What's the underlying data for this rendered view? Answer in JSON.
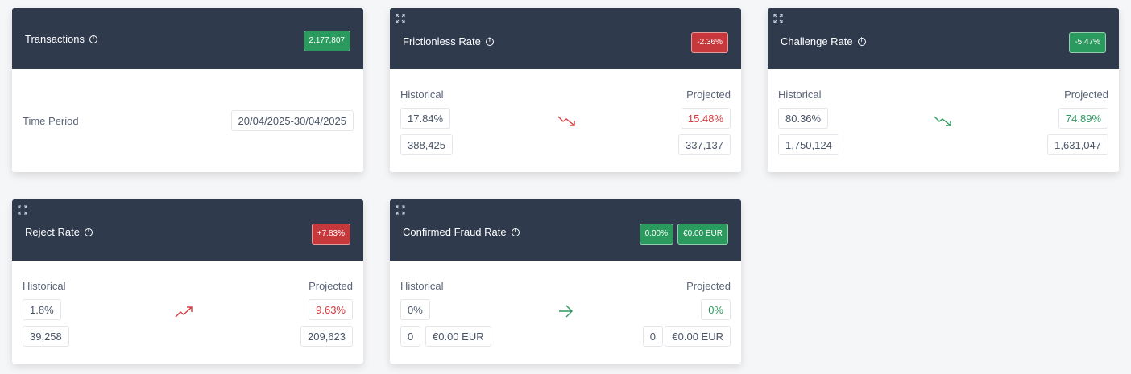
{
  "colors": {
    "header": "#2f3a4d",
    "positive": "#2b9a5e",
    "negative": "#c7383c"
  },
  "labels": {
    "historical": "Historical",
    "projected": "Projected"
  },
  "transactions": {
    "title": "Transactions",
    "badge": "2,177,807",
    "period_label": "Time Period",
    "period_value": "20/04/2025-30/04/2025"
  },
  "frictionless": {
    "title": "Frictionless Rate",
    "badge": "-2.36%",
    "hist_rate": "17.84%",
    "hist_count": "388,425",
    "proj_rate": "15.48%",
    "proj_count": "337,137",
    "trend_icon": "trend-down-icon"
  },
  "challenge": {
    "title": "Challenge Rate",
    "badge": "-5.47%",
    "hist_rate": "80.36%",
    "hist_count": "1,750,124",
    "proj_rate": "74.89%",
    "proj_count": "1,631,047",
    "trend_icon": "trend-down-icon"
  },
  "reject": {
    "title": "Reject Rate",
    "badge": "+7.83%",
    "hist_rate": "1.8%",
    "hist_count": "39,258",
    "proj_rate": "9.63%",
    "proj_count": "209,623",
    "trend_icon": "trend-up-icon"
  },
  "fraud": {
    "title": "Confirmed Fraud Rate",
    "badge_rate": "0.00%",
    "badge_amount": "€0.00 EUR",
    "hist_rate": "0%",
    "hist_count": "0",
    "hist_amount": "€0.00 EUR",
    "proj_rate": "0%",
    "proj_count": "0",
    "proj_amount": "€0.00 EUR",
    "trend_icon": "arrow-right-icon"
  }
}
